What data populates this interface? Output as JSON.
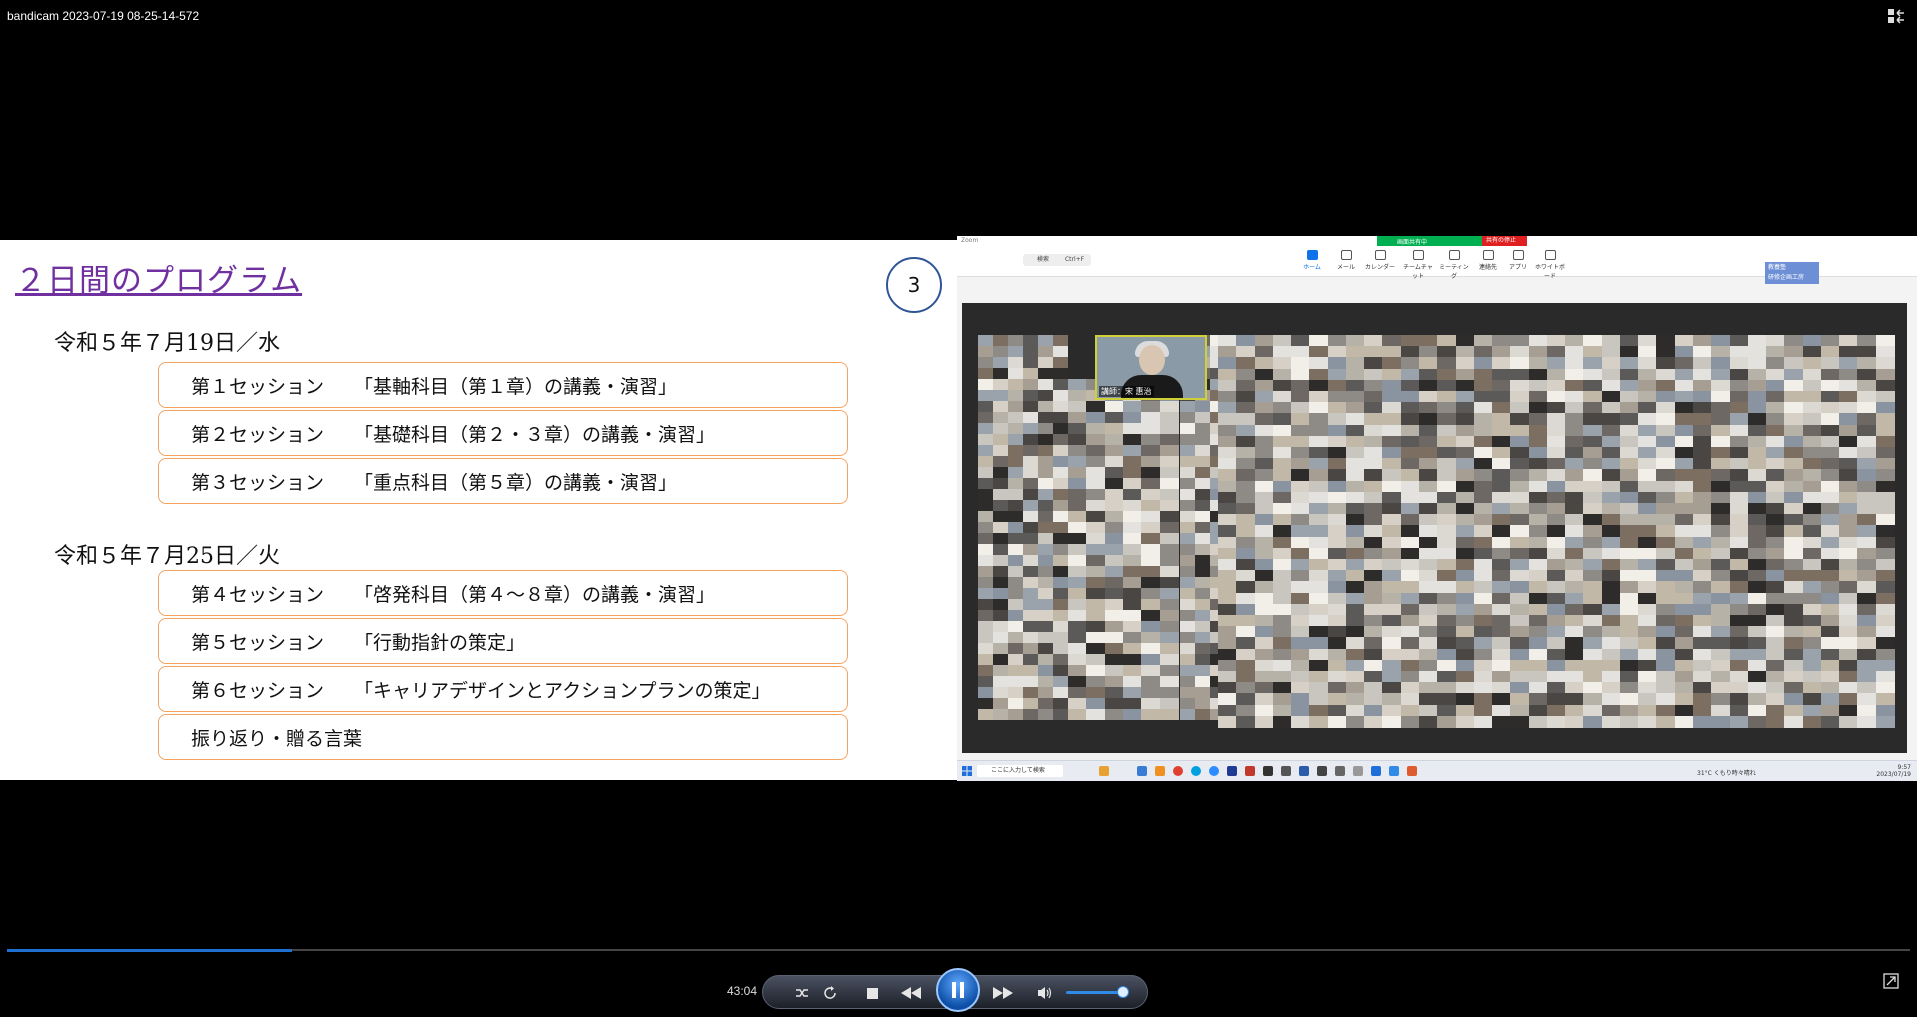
{
  "window": {
    "title": "bandicam 2023-07-19 08-25-14-572"
  },
  "slide": {
    "title": "２日間のプログラム",
    "page_number": "3",
    "day1": {
      "date": "令和５年７月19日／水",
      "sessions": [
        {
          "num": "第１セッション",
          "title": "「基軸科目（第１章）の講義・演習」"
        },
        {
          "num": "第２セッション",
          "title": "「基礎科目（第２・３章）の講義・演習」"
        },
        {
          "num": "第３セッション",
          "title": "「重点科目（第５章）の講義・演習」"
        }
      ]
    },
    "day2": {
      "date": "令和５年７月25日／火",
      "sessions": [
        {
          "num": "第４セッション",
          "title": "「啓発科目（第４～８章）の講義・演習」"
        },
        {
          "num": "第５セッション",
          "title": "「行動指針の策定」"
        },
        {
          "num": "第６セッション",
          "title": "「キャリアデザインとアクションプランの策定」"
        },
        {
          "num": "振り返り・贈る言葉",
          "title": ""
        }
      ]
    }
  },
  "zoom": {
    "app_label": "Zoom",
    "share_status": "画面共有中",
    "stop_share": "共有の停止",
    "search_label": "検索",
    "search_shortcut": "Ctrl+F",
    "nav_items": [
      "ホーム",
      "メール",
      "カレンダー",
      "チームチャット",
      "ミーティング",
      "連絡先",
      "アプリ",
      "ホワイトボード"
    ],
    "badge_line1": "教養塾",
    "badge_line2": "研修企画工房",
    "speaker_label": "講師：宋 惠治",
    "taskbar_search": "ここに入力して検索",
    "weather": "31°C  くもり時々晴れ",
    "clock_time": "9:57",
    "clock_date": "2023/07/19"
  },
  "player": {
    "elapsed": "43:04",
    "progress": 0.15,
    "volume": 0.9
  },
  "colors": {
    "slide_title": "#7030a0",
    "session_border": "#f4a460",
    "page_circle": "#2f5597",
    "progress": "#1f6fd1"
  }
}
